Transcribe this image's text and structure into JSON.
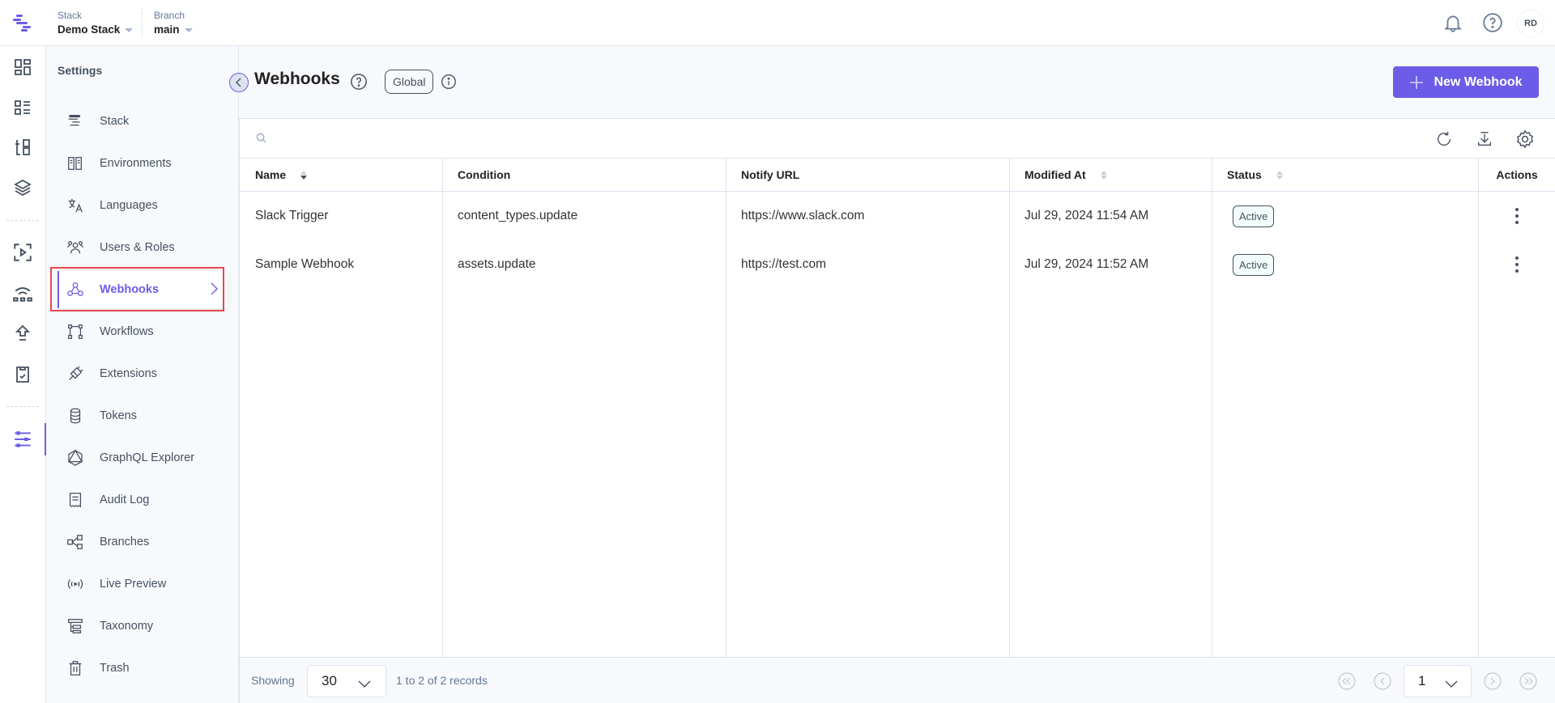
{
  "topbar": {
    "stack_label": "Stack",
    "stack_value": "Demo Stack",
    "branch_label": "Branch",
    "branch_value": "main",
    "user_initials": "RD",
    "icons": [
      "bell-icon",
      "help-icon"
    ]
  },
  "rail": {
    "icons": [
      "dashboard-icon",
      "entries-icon",
      "content-models-icon",
      "assets-layers-icon",
      "releases-icon",
      "connectivity-icon",
      "deploy-icon",
      "tasks-icon",
      "settings-sliders-icon"
    ],
    "active": "settings-sliders-icon"
  },
  "sidebar": {
    "title": "Settings",
    "items": [
      {
        "label": "Stack",
        "icon": "stack-icon"
      },
      {
        "label": "Environments",
        "icon": "environments-icon"
      },
      {
        "label": "Languages",
        "icon": "languages-icon"
      },
      {
        "label": "Users & Roles",
        "icon": "users-icon"
      },
      {
        "label": "Webhooks",
        "icon": "webhook-icon",
        "active": true
      },
      {
        "label": "Workflows",
        "icon": "workflow-icon"
      },
      {
        "label": "Extensions",
        "icon": "plug-icon"
      },
      {
        "label": "Tokens",
        "icon": "database-icon"
      },
      {
        "label": "GraphQL Explorer",
        "icon": "graphql-icon"
      },
      {
        "label": "Audit Log",
        "icon": "receipt-icon"
      },
      {
        "label": "Branches",
        "icon": "branches-icon"
      },
      {
        "label": "Live Preview",
        "icon": "broadcast-icon"
      },
      {
        "label": "Taxonomy",
        "icon": "taxonomy-icon"
      },
      {
        "label": "Trash",
        "icon": "trash-icon"
      }
    ]
  },
  "header": {
    "title": "Webhooks",
    "scope_badge": "Global",
    "new_button_label": "New Webhook"
  },
  "search": {
    "placeholder": "",
    "value": ""
  },
  "table": {
    "columns": [
      {
        "label": "Name",
        "sortable": true,
        "sorted": "desc"
      },
      {
        "label": "Condition",
        "sortable": false
      },
      {
        "label": "Notify URL",
        "sortable": false
      },
      {
        "label": "Modified At",
        "sortable": true
      },
      {
        "label": "Status",
        "sortable": true
      },
      {
        "label": "Actions",
        "sortable": false
      }
    ],
    "rows": [
      {
        "name": "Slack Trigger",
        "condition": "content_types.update",
        "url": "https://www.slack.com",
        "modified": "Jul 29, 2024 11:54 AM",
        "status": "Active"
      },
      {
        "name": "Sample Webhook",
        "condition": "assets.update",
        "url": "https://test.com",
        "modified": "Jul 29, 2024 11:52 AM",
        "status": "Active"
      }
    ]
  },
  "footer": {
    "showing_label": "Showing",
    "per_page": "30",
    "records_text": "1 to 2 of 2 records",
    "current_page": "1"
  },
  "colors": {
    "accent": "#6c5ce7",
    "highlight": "#e5484d",
    "text_muted": "#647696"
  }
}
